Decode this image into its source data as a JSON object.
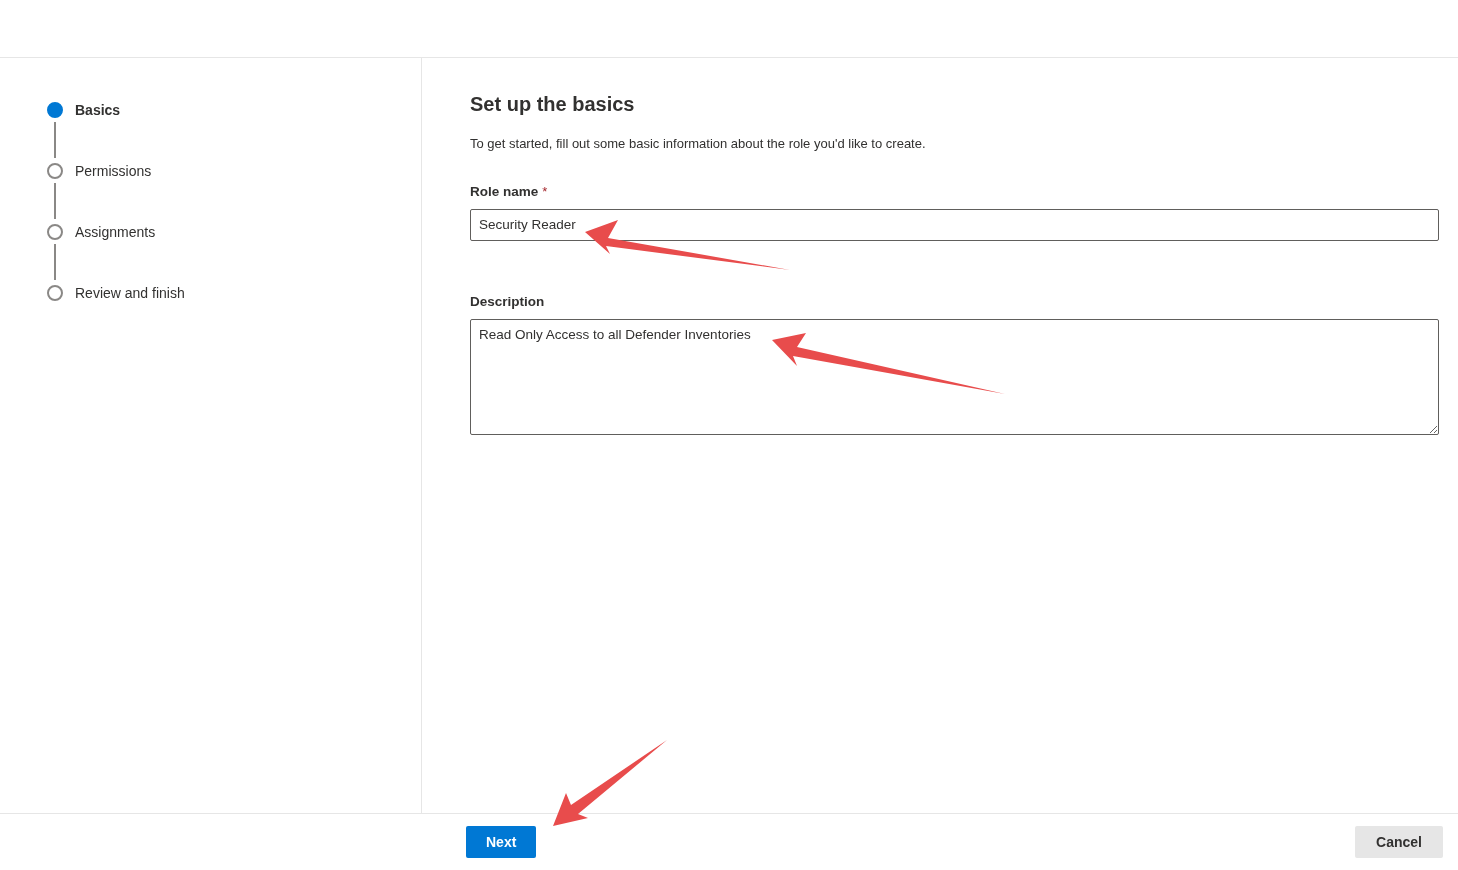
{
  "steps": [
    {
      "label": "Basics",
      "selected": true
    },
    {
      "label": "Permissions",
      "selected": false
    },
    {
      "label": "Assignments",
      "selected": false
    },
    {
      "label": "Review and finish",
      "selected": false
    }
  ],
  "form": {
    "title": "Set up the basics",
    "intro": "To get started, fill out some basic information about the role you'd like to create.",
    "fields": [
      {
        "kind": "text",
        "label": "Role name",
        "required_mark": "*",
        "value": "Security Reader"
      },
      {
        "kind": "textarea",
        "label": "Description",
        "value": "Read Only Access to all Defender Inventories"
      }
    ]
  },
  "buttons": [
    {
      "kind": "primary",
      "label": "Next"
    },
    {
      "kind": "secondary",
      "label": "Cancel"
    }
  ]
}
